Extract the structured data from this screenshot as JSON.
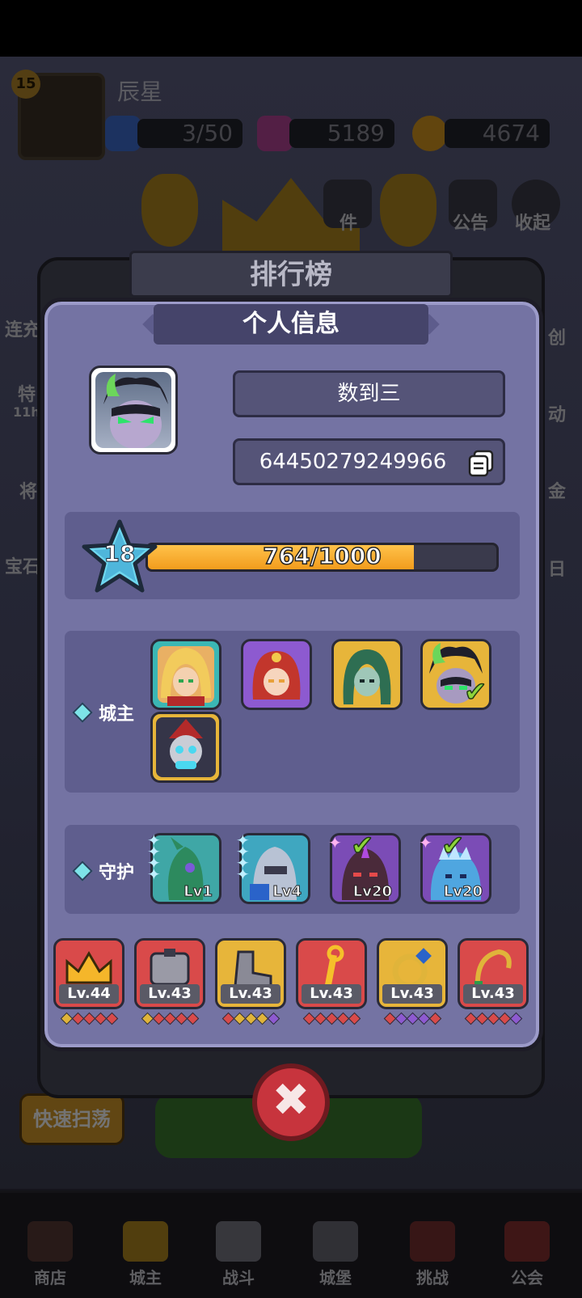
{
  "background": {
    "player_level": "15",
    "player_name": "辰星",
    "energy": "3/50",
    "gems": "5189",
    "coins": "4674",
    "top_icons": [
      "件",
      "公告",
      "收起"
    ],
    "left_labels": [
      "连充",
      "特",
      "11h",
      "将",
      "宝石"
    ],
    "right_labels": [
      "创",
      "动",
      "金",
      "日"
    ],
    "quick_sweep": "快速扫荡",
    "nav": [
      "商店",
      "城主",
      "战斗",
      "城堡",
      "挑战",
      "公会"
    ]
  },
  "leaderboard": {
    "title": "排行榜"
  },
  "modal": {
    "title": "个人信息",
    "player_name": "数到三",
    "player_id": "64450279249966",
    "level": "18",
    "xp_text": "764/1000",
    "xp_fraction": 0.764,
    "lord_label": "城主",
    "guard_label": "守护",
    "guards": [
      {
        "level": "Lv1"
      },
      {
        "level": "Lv4"
      },
      {
        "level": "Lv20"
      },
      {
        "level": "Lv20"
      }
    ],
    "equipment": [
      {
        "level": "Lv.44",
        "icon": "crown-icon",
        "color": "red"
      },
      {
        "level": "Lv.43",
        "icon": "armor-icon",
        "color": "red"
      },
      {
        "level": "Lv.43",
        "icon": "boot-icon",
        "color": "yellow"
      },
      {
        "level": "Lv.43",
        "icon": "staff-icon",
        "color": "red"
      },
      {
        "level": "Lv.43",
        "icon": "ring-icon",
        "color": "yellow"
      },
      {
        "level": "Lv.43",
        "icon": "whip-icon",
        "color": "red"
      }
    ]
  },
  "colors": {
    "modal_bg": "#7473a3",
    "xp_fill": "#f29c1d",
    "close_button": "#c7343d"
  }
}
